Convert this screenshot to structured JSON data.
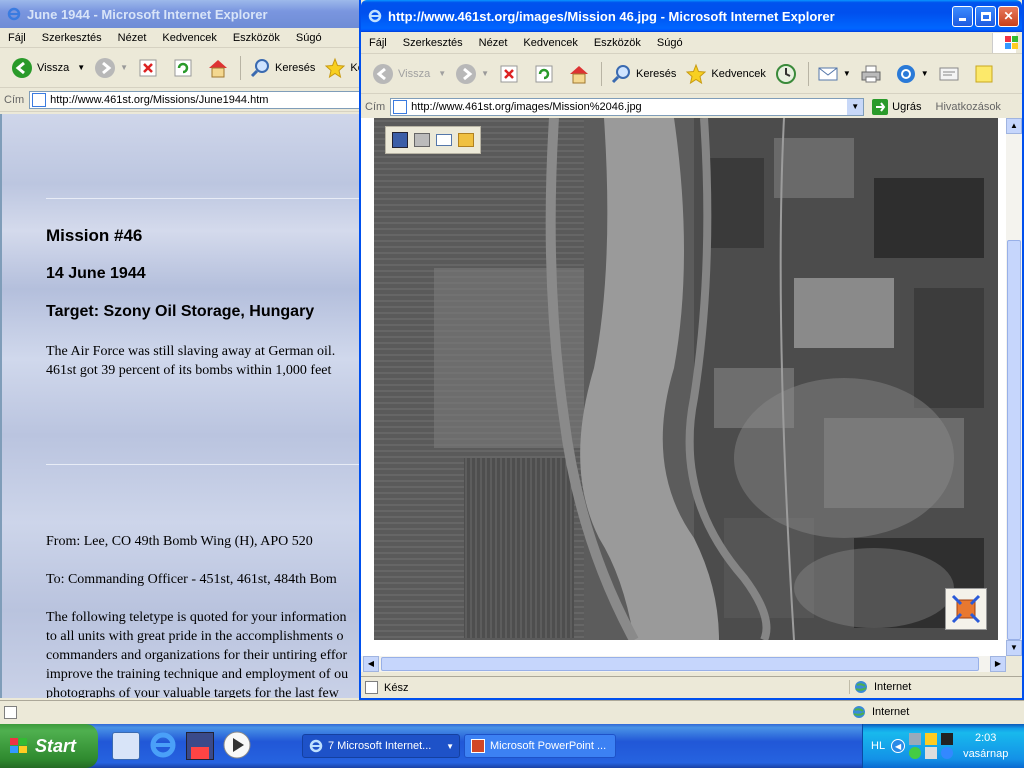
{
  "back_window": {
    "title": "June 1944 - Microsoft Internet Explorer",
    "menu": [
      "Fájl",
      "Szerkesztés",
      "Nézet",
      "Kedvencek",
      "Eszközök",
      "Súgó"
    ],
    "toolbar": {
      "back": "Vissza",
      "search": "Keresés",
      "favorites": "Ke"
    },
    "address_label": "Cím",
    "address": "http://www.461st.org/Missions/June1944.htm",
    "status_zone": "Internet",
    "page": {
      "mission": "Mission #46",
      "date": "14 June 1944",
      "target": "Target: Szony Oil Storage, Hungary",
      "para1_line1": "The Air Force was still slaving away at German oil.",
      "para1_line2": "461st got 39 percent of its bombs within 1,000 feet",
      "from": "From: Lee, CO 49th Bomb Wing (H), APO 520",
      "to": "To: Commanding Officer - 451st, 461st, 484th Bom",
      "para2_lines": [
        "The following teletype is quoted for your information",
        "to all units with great pride in the accomplishments o",
        "commanders and organizations for their untiring effor",
        "improve the training technique and employment of ou",
        "photographs of your valuable targets for the last few"
      ]
    }
  },
  "front_window": {
    "title": "http://www.461st.org/images/Mission 46.jpg - Microsoft Internet Explorer",
    "menu": [
      "Fájl",
      "Szerkesztés",
      "Nézet",
      "Kedvencek",
      "Eszközök",
      "Súgó"
    ],
    "toolbar": {
      "back": "Vissza",
      "search": "Keresés",
      "favorites": "Kedvencek"
    },
    "address_label": "Cím",
    "address": "http://www.461st.org/images/Mission%2046.jpg",
    "go_label": "Ugrás",
    "links_label": "Hivatkozások",
    "status_text": "Kész",
    "status_zone": "Internet"
  },
  "taskbar": {
    "start_label": "Start",
    "tasks": [
      {
        "label": "7 Microsoft Internet..."
      },
      {
        "label": "Microsoft PowerPoint ..."
      }
    ],
    "lang": "HL",
    "clock": "2:03",
    "day": "vasárnap"
  },
  "colors": {
    "xp_blue": "#0050ee",
    "taskbar_blue": "#2157d7",
    "start_green": "#3c9a3c"
  }
}
